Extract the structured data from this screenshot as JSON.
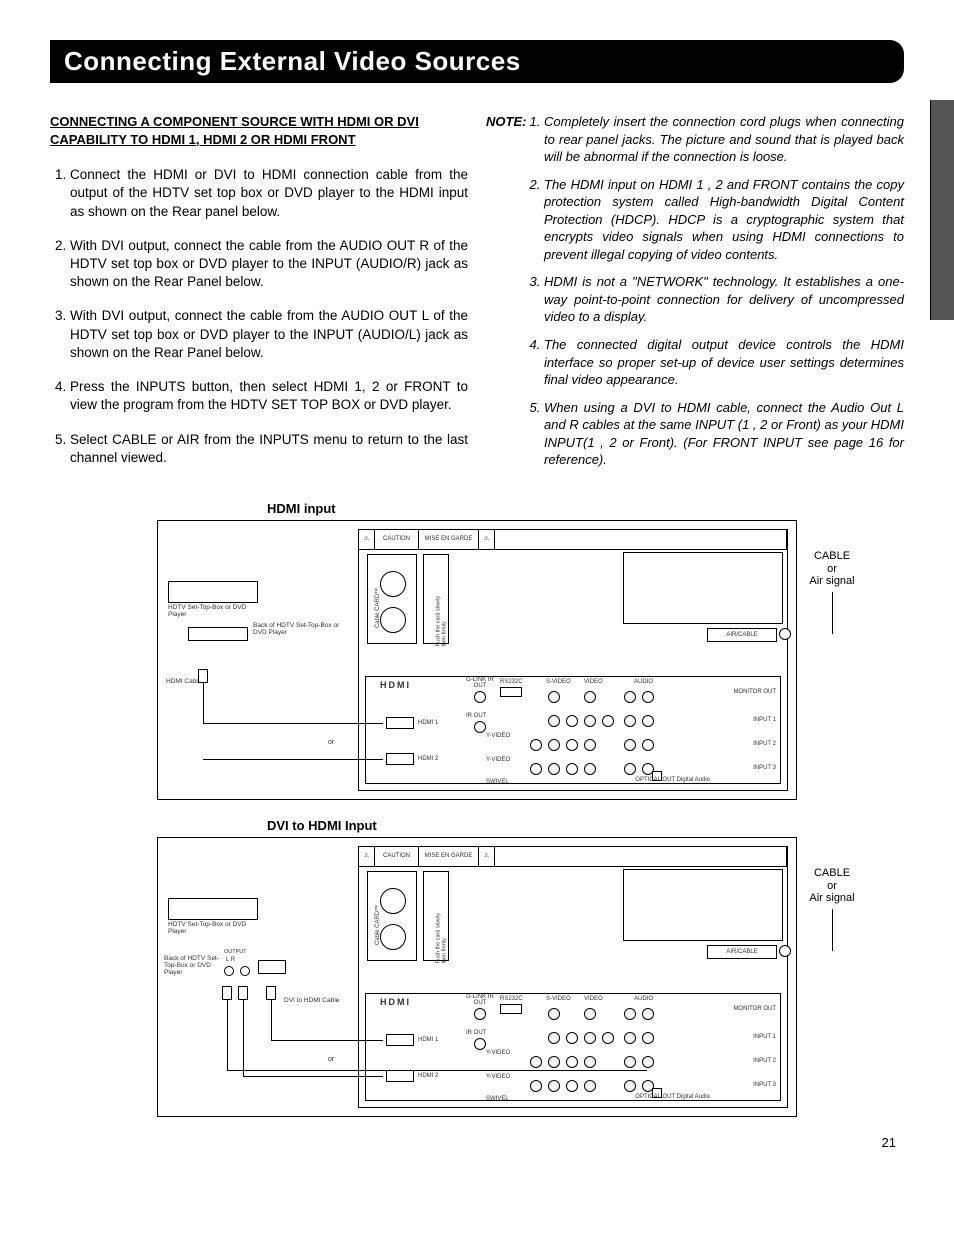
{
  "header_title": "Connecting External Video Sources",
  "section_heading": "CONNECTING A COMPONENT SOURCE WITH HDMI OR DVI CAPABILITY TO HDMI 1, HDMI 2 OR HDMI FRONT",
  "steps": [
    "Connect the HDMI or DVI to HDMI connection cable from the output of the HDTV set top box or DVD player to the HDMI input as shown on the Rear panel below.",
    "With DVI output, connect the cable from the AUDIO OUT R of the HDTV set top box or DVD player to the INPUT (AUDIO/R) jack as shown on the Rear Panel below.",
    "With DVI output, connect the cable from the AUDIO OUT L of the HDTV set top box or DVD player to the INPUT (AUDIO/L) jack as shown on the Rear Panel below.",
    "Press the INPUTS button, then select HDMI 1, 2 or FRONT to view the program from the HDTV SET TOP BOX or DVD player.",
    "Select CABLE or AIR from the INPUTS menu to return to the last channel viewed."
  ],
  "note_label": "NOTE:",
  "notes": [
    "Completely insert the connection cord plugs when connecting to rear panel jacks. The picture and sound that is played back will be abnormal if the connection is loose.",
    "The HDMI input on HDMI 1 , 2 and FRONT contains the copy protection system called High-bandwidth Digital Content Protection (HDCP). HDCP is a cryptographic system that encrypts video signals when using HDMI connections to prevent illegal copying of video contents.",
    "HDMI is not a \"NETWORK\" technology. It establishes a one-way point-to-point connection for delivery of uncompressed video to a display.",
    "The connected digital output device controls the HDMI interface so proper set-up of device user settings determines final video appearance.",
    "When using a DVI to HDMI cable, connect the Audio Out L and R cables at the same INPUT (1 , 2 or Front) as your HDMI INPUT(1 , 2 or Front). (For FRONT INPUT see page 16 for reference)."
  ],
  "diagram1_title": "HDMI input",
  "diagram2_title": "DVI to HDMI Input",
  "signal_label": "CABLE\nor\nAir signal",
  "panel": {
    "caution": "CAUTION",
    "mise": "MISE EN GARDE",
    "cablecard": "Cable CARD™",
    "push": "Push the card slowly then firmly",
    "aircable": "AIR/CABLE",
    "hdmi_logo": "HDMI",
    "hdmi1": "HDMI 1",
    "hdmi2": "HDMI 2",
    "glink": "G-LINK\nIR OUT",
    "rs232c": "RS232C",
    "irout": "IR OUT",
    "svideo": "S-VIDEO",
    "video": "VIDEO",
    "audio": "AUDIO",
    "monitor": "MONITOR\nOUT",
    "input1": "INPUT 1",
    "input2": "INPUT 2",
    "input3": "INPUT 3",
    "yvideo": "Y-VIDEO",
    "swivel": "SWIVEL",
    "optical": "OPTICAL OUT\nDigital Audio",
    "or": "or"
  },
  "src": {
    "hdtv_dvd": "HDTV Set-Top-Box or\nDVD Player",
    "back_of": "Back of\nHDTV Set-Top-Box or\nDVD Player",
    "back_of2": "Back of HDTV\nSet-Top-Box\nor DVD Player",
    "hdmi_cable": "HDMI\nCable",
    "dvi_cable": "DVI to HDMI\nCable",
    "output": "OUTPUT",
    "lr": "L    R"
  },
  "page_number": "21"
}
